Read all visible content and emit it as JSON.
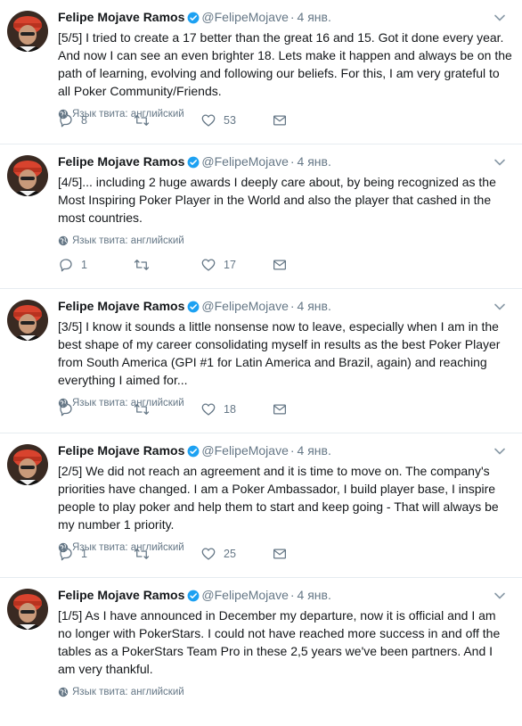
{
  "tweets": [
    {
      "name": "Felipe Mojave Ramos",
      "handle": "@FelipeMojave",
      "separator": "·",
      "time": "4 янв.",
      "text": "[5/5] I tried to create a 17 better than the great 16 and 15. Got it done every year. And now I can see an even brighter 18. Lets make it happen and always be on the path of learning, evolving and following our beliefs. For this, I am very grateful to all Poker Community/Friends.",
      "lang": "Язык твита: английский",
      "replies": "8",
      "retweets": "",
      "likes": "53"
    },
    {
      "name": "Felipe Mojave Ramos",
      "handle": "@FelipeMojave",
      "separator": "·",
      "time": "4 янв.",
      "text": "[4/5]... including 2 huge awards I deeply care about, by being recognized as the Most Inspiring Poker Player in the World and also the player that cashed in the most countries.",
      "lang": "Язык твита: английский",
      "replies": "1",
      "retweets": "",
      "likes": "17"
    },
    {
      "name": "Felipe Mojave Ramos",
      "handle": "@FelipeMojave",
      "separator": "·",
      "time": "4 янв.",
      "text": "[3/5] I know it sounds a little nonsense now to leave, especially when I am in the best shape of my career consolidating myself in results as the best Poker Player from South America (GPI #1 for Latin America and Brazil, again) and reaching everything I aimed for...",
      "lang": "Язык твита: английский",
      "replies": "",
      "retweets": "",
      "likes": "18"
    },
    {
      "name": "Felipe Mojave Ramos",
      "handle": "@FelipeMojave",
      "separator": "·",
      "time": "4 янв.",
      "text": "[2/5] We did not reach an agreement and it is time to move on. The company's priorities have changed. I am a Poker Ambassador, I build player base, I inspire people to play poker and help them to start and keep going - That will always be my number 1 priority.",
      "lang": "Язык твита: английский",
      "replies": "1",
      "retweets": "",
      "likes": "25"
    },
    {
      "name": "Felipe Mojave Ramos",
      "handle": "@FelipeMojave",
      "separator": "·",
      "time": "4 янв.",
      "text": "[1/5] As I have announced in December my departure, now it is official and I am no longer with PokerStars. I could not have reached more success in and off the tables as a PokerStars Team Pro in these 2,5 years we've been partners. And I am very thankful.",
      "lang": "Язык твита: английский",
      "replies": "",
      "retweets": "",
      "likes": ""
    }
  ],
  "icons": {
    "verified": "verified-badge-icon",
    "caret": "chevron-down-icon",
    "globe": "globe-icon",
    "reply": "reply-icon",
    "retweet": "retweet-icon",
    "like": "heart-icon",
    "dm": "envelope-icon"
  },
  "colors": {
    "verified": "#1da1f2",
    "muted": "#657786",
    "divider": "#e6ecf0"
  }
}
